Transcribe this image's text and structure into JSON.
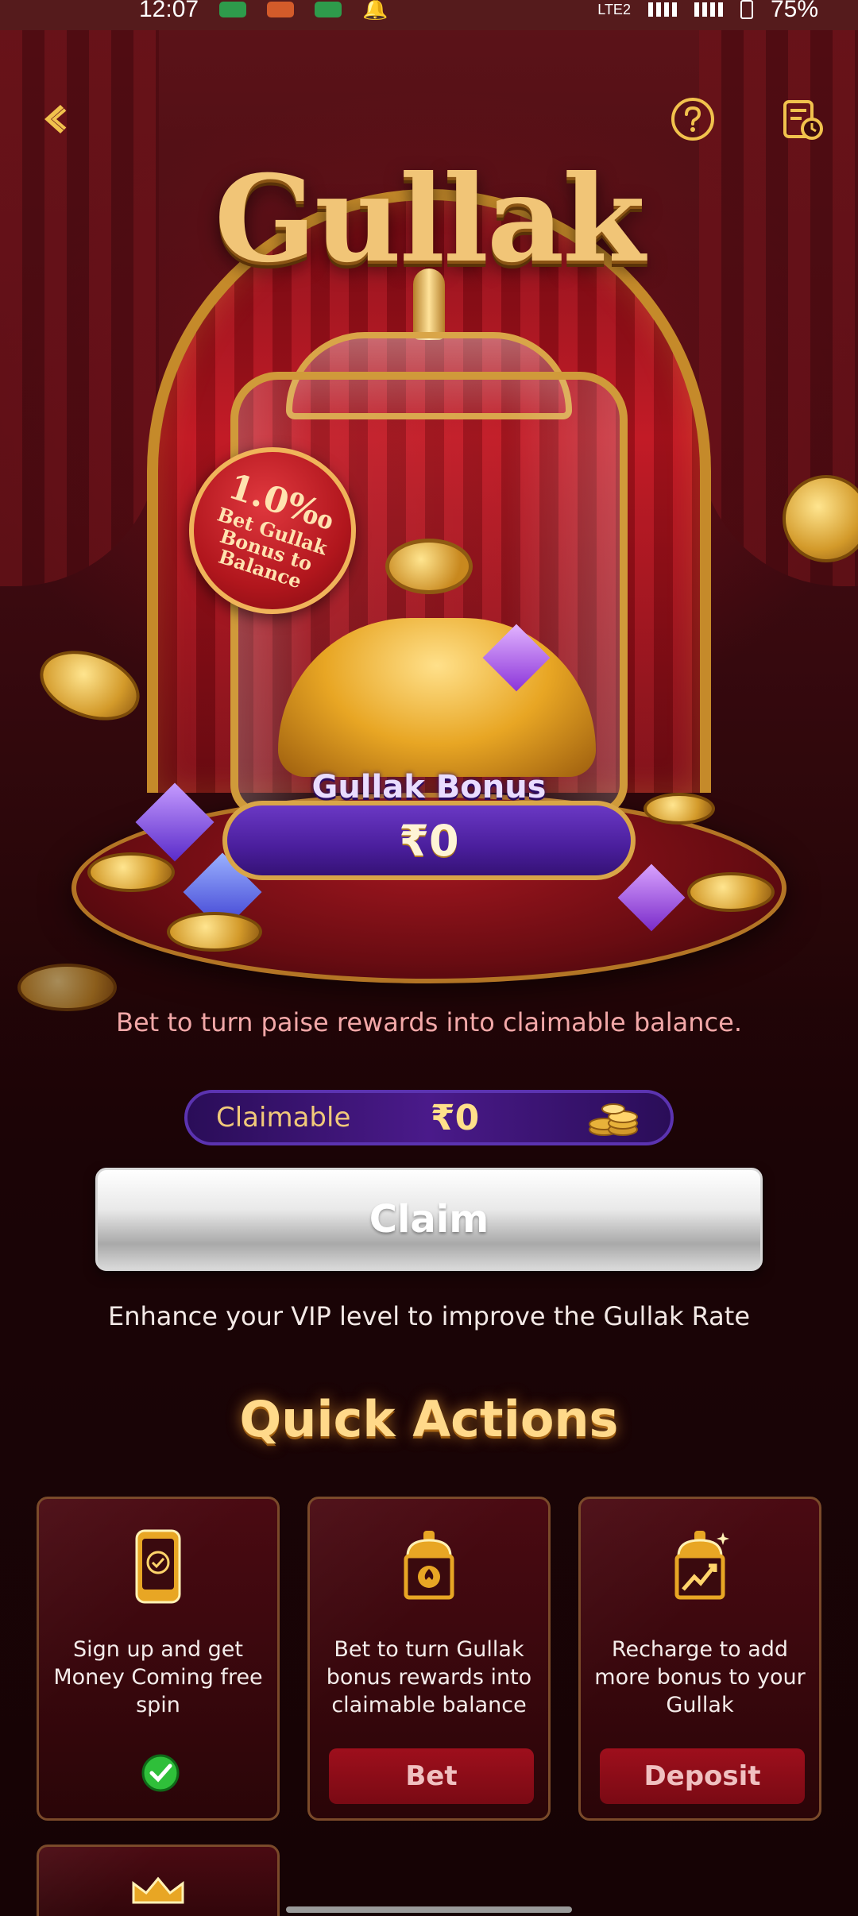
{
  "status_bar": {
    "time": "12:07",
    "network": "LTE2",
    "battery": "75%"
  },
  "hero": {
    "logo": "Gullak",
    "rate_tag": {
      "value": "1.0‰",
      "description": "Bet Gullak Bonus to Balance"
    },
    "bonus_label": "Gullak Bonus",
    "bonus_amount": "₹0"
  },
  "subtitle": "Bet to turn paise rewards into claimable balance.",
  "claimable": {
    "label": "Claimable",
    "amount": "₹0"
  },
  "claim_button": "Claim",
  "vip_note": "Enhance your VIP level to improve the Gullak Rate",
  "quick_actions": {
    "title": "Quick Actions",
    "cards": [
      {
        "icon": "phone-check-icon",
        "text": "Sign up and get Money Coming free spin",
        "status": "completed"
      },
      {
        "icon": "gullak-spade-icon",
        "text": "Bet to turn Gullak bonus rewards into claimable balance",
        "action": "Bet"
      },
      {
        "icon": "gullak-growth-icon",
        "text": "Recharge to add more bonus to your Gullak",
        "action": "Deposit"
      },
      {
        "icon": "crown-icon"
      }
    ]
  },
  "colors": {
    "gold": "#ffd98a",
    "accent_red": "#9e0f1c",
    "claim_bar_purple": "#4a1a8a",
    "success_green": "#2fbf3a"
  }
}
